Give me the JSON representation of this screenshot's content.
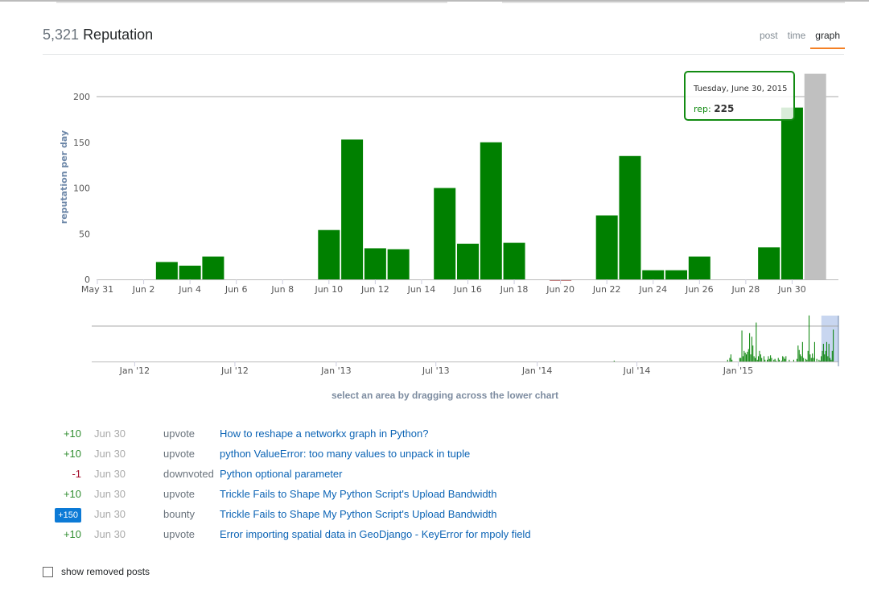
{
  "header": {
    "reputation": "5,321",
    "label": "Reputation"
  },
  "tabs": [
    {
      "label": "post"
    },
    {
      "label": "time"
    },
    {
      "label": "graph",
      "active": true
    }
  ],
  "tooltip": {
    "date": "Tuesday, June 30, 2015",
    "key": "rep:",
    "value": "225"
  },
  "colors": {
    "positive": "#008000",
    "negative": "#8b0000",
    "highlight": "#c0c0c0",
    "selection": "#c8d6f0",
    "tab_accent": "#f48024",
    "link": "#0c64b5"
  },
  "chart_data": [
    {
      "type": "bar",
      "ylabel": "reputation per day",
      "ylim": [
        0,
        230
      ],
      "yticks": [
        0,
        50,
        100,
        150,
        200
      ],
      "xlim": [
        "2015-05-31",
        "2015-07-02"
      ],
      "xtick_labels": [
        "May 31",
        "Jun 2",
        "Jun 4",
        "Jun 6",
        "Jun 8",
        "Jun 10",
        "Jun 12",
        "Jun 14",
        "Jun 16",
        "Jun 18",
        "Jun 20",
        "Jun 22",
        "Jun 24",
        "Jun 26",
        "Jun 28",
        "Jun 30"
      ],
      "grid": "y at 200",
      "points": [
        {
          "x": "2015-06-03",
          "y": 19
        },
        {
          "x": "2015-06-04",
          "y": 15
        },
        {
          "x": "2015-06-05",
          "y": 25
        },
        {
          "x": "2015-06-10",
          "y": 54
        },
        {
          "x": "2015-06-11",
          "y": 153
        },
        {
          "x": "2015-06-12",
          "y": 34
        },
        {
          "x": "2015-06-13",
          "y": 33
        },
        {
          "x": "2015-06-15",
          "y": 100
        },
        {
          "x": "2015-06-16",
          "y": 39
        },
        {
          "x": "2015-06-17",
          "y": 150
        },
        {
          "x": "2015-06-18",
          "y": 40
        },
        {
          "x": "2015-06-20",
          "y": -1
        },
        {
          "x": "2015-06-22",
          "y": 70
        },
        {
          "x": "2015-06-23",
          "y": 135
        },
        {
          "x": "2015-06-24",
          "y": 10
        },
        {
          "x": "2015-06-25",
          "y": 10
        },
        {
          "x": "2015-06-26",
          "y": 25
        },
        {
          "x": "2015-06-29",
          "y": 35
        },
        {
          "x": "2015-06-30",
          "y": 188
        },
        {
          "x": "2015-07-01",
          "y": 225,
          "highlighted": true
        }
      ]
    },
    {
      "type": "bar",
      "role": "navigator",
      "xlim": [
        "2011-10-15",
        "2015-07-02"
      ],
      "xtick_labels": [
        "Jan '12",
        "Jul '12",
        "Jan '13",
        "Jul '13",
        "Jan '14",
        "Jul '14",
        "Jan '15"
      ],
      "selection": [
        "2015-06-01",
        "2015-07-02"
      ],
      "grid": "y at 200",
      "ylim": [
        0,
        260
      ],
      "isolated": [
        {
          "x": "2014-05-20",
          "y": 5
        }
      ],
      "series": {
        "start": "2014-12-04",
        "interval_days": 2,
        "values": [
          0,
          0,
          0,
          0,
          10,
          0,
          20,
          40,
          10,
          0,
          0,
          0,
          0,
          0,
          0,
          20,
          20,
          175,
          30,
          60,
          50,
          40,
          55,
          70,
          160,
          40,
          140,
          90,
          30,
          20,
          220,
          10,
          30,
          60,
          40,
          20,
          0,
          30,
          10,
          0,
          10,
          30,
          15,
          35,
          20,
          0,
          10,
          15,
          5,
          0,
          20,
          10,
          0,
          5,
          30,
          25,
          15,
          30,
          0,
          0,
          10,
          0,
          0,
          0,
          10,
          0,
          0,
          15,
          90,
          65,
          40,
          30,
          110,
          20,
          0,
          15,
          10,
          60,
          260,
          40,
          20,
          45,
          20,
          110,
          0,
          15,
          0,
          10,
          5,
          30,
          60,
          100,
          40,
          60,
          110,
          30,
          100,
          20,
          10,
          60,
          180
        ]
      }
    }
  ],
  "hint": "select an area by dragging across the lower chart",
  "events": [
    {
      "amount": "+10",
      "kind": "pos",
      "date": "Jun 30",
      "type": "upvote",
      "title": "How to reshape a networkx graph in Python?"
    },
    {
      "amount": "+10",
      "kind": "pos",
      "date": "Jun 30",
      "type": "upvote",
      "title": "python ValueError: too many values to unpack in tuple"
    },
    {
      "amount": "-1",
      "kind": "neg",
      "date": "Jun 30",
      "type": "downvoted",
      "title": "Python optional parameter"
    },
    {
      "amount": "+10",
      "kind": "pos",
      "date": "Jun 30",
      "type": "upvote",
      "title": "Trickle Fails to Shape My Python Script's Upload Bandwidth"
    },
    {
      "amount": "+150",
      "kind": "bounty",
      "date": "Jun 30",
      "type": "bounty",
      "title": "Trickle Fails to Shape My Python Script's Upload Bandwidth"
    },
    {
      "amount": "+10",
      "kind": "pos",
      "date": "Jun 30",
      "type": "upvote",
      "title": "Error importing spatial data in GeoDjango - KeyError for mpoly field"
    }
  ],
  "show_removed": {
    "label": "show removed posts",
    "checked": false
  }
}
